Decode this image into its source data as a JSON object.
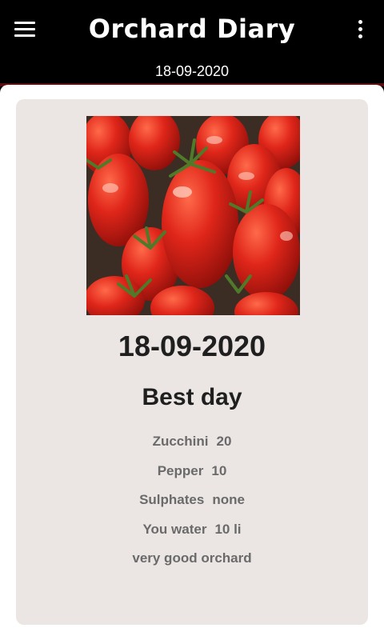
{
  "app": {
    "title": "Orchard Diary",
    "date": "18-09-2020",
    "menu_icon": "hamburger-menu-icon",
    "more_icon": "more-vertical-icon"
  },
  "entry": {
    "image": "tomatoes-photo",
    "date": "18-09-2020",
    "title": "Best day",
    "items": [
      {
        "label": "Zucchini",
        "value": "20"
      },
      {
        "label": "Pepper",
        "value": "10"
      },
      {
        "label": "Sulphates",
        "value": "none"
      },
      {
        "label": "You water",
        "value": "10 li"
      }
    ],
    "note": "very good orchard"
  },
  "colors": {
    "app_bar": "#000000",
    "card": "#ebe6e4",
    "text_dark": "#1f1f1f",
    "text_muted": "#6a6a6a",
    "tomato": "#d8231a"
  }
}
